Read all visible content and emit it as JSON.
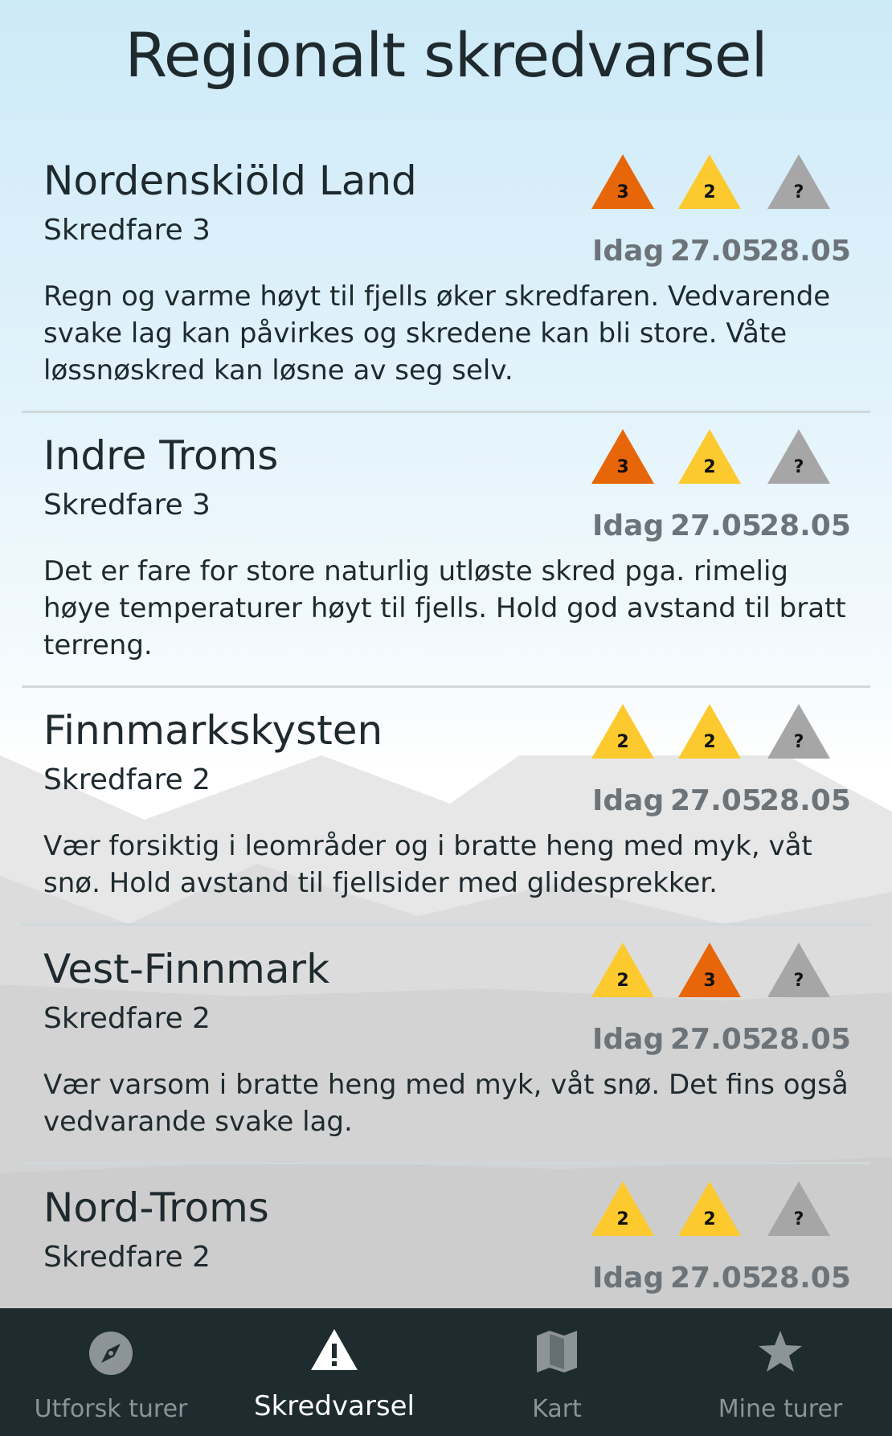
{
  "app": {
    "title": "Regionalt skredvarsel"
  },
  "colors": {
    "level3": "#e8660a",
    "level2": "#fcca2f",
    "unknown": "#a6a6a6",
    "nav_bg": "#1e2b2f"
  },
  "regions": [
    {
      "name": "Nordenskiöld Land",
      "danger": "Skredfare 3",
      "text": "Regn og varme høyt til fjells øker skredfaren. Vedvarende svake lag kan påvirkes og skredene kan bli store. Våte løssnøskred kan løsne av seg selv.",
      "forecast": [
        {
          "level": "3",
          "day": "Idag"
        },
        {
          "level": "2",
          "day": "27.05"
        },
        {
          "level": "?",
          "day": "28.05"
        }
      ]
    },
    {
      "name": "Indre Troms",
      "danger": "Skredfare 3",
      "text": "Det er fare for store naturlig utløste skred pga. rimelig høye temperaturer høyt til fjells. Hold god avstand til bratt terreng.",
      "forecast": [
        {
          "level": "3",
          "day": "Idag"
        },
        {
          "level": "2",
          "day": "27.05"
        },
        {
          "level": "?",
          "day": "28.05"
        }
      ]
    },
    {
      "name": "Finnmarkskysten",
      "danger": "Skredfare 2",
      "text": "Vær forsiktig i leområder og i bratte heng med myk, våt snø. Hold avstand til fjellsider med glidesprekker.",
      "forecast": [
        {
          "level": "2",
          "day": "Idag"
        },
        {
          "level": "2",
          "day": "27.05"
        },
        {
          "level": "?",
          "day": "28.05"
        }
      ]
    },
    {
      "name": "Vest-Finnmark",
      "danger": "Skredfare 2",
      "text": "Vær varsom i bratte heng med myk, våt snø. Det fins også vedvarande svake lag.",
      "forecast": [
        {
          "level": "2",
          "day": "Idag"
        },
        {
          "level": "3",
          "day": "27.05"
        },
        {
          "level": "?",
          "day": "28.05"
        }
      ]
    },
    {
      "name": "Nord-Troms",
      "danger": "Skredfare 2",
      "text": "",
      "forecast": [
        {
          "level": "2",
          "day": "Idag"
        },
        {
          "level": "2",
          "day": "27.05"
        },
        {
          "level": "?",
          "day": "28.05"
        }
      ]
    }
  ],
  "nav": {
    "items": [
      {
        "label": "Utforsk turer",
        "icon": "compass-icon",
        "active": false
      },
      {
        "label": "Skredvarsel",
        "icon": "warning-icon",
        "active": true
      },
      {
        "label": "Kart",
        "icon": "map-icon",
        "active": false
      },
      {
        "label": "Mine turer",
        "icon": "star-icon",
        "active": false
      }
    ]
  }
}
